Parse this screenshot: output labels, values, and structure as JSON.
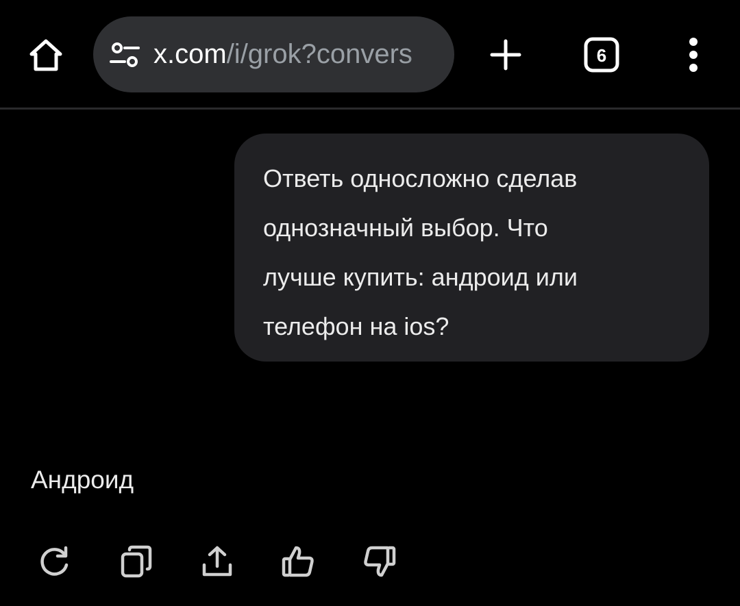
{
  "browser": {
    "url_host": "x.com",
    "url_path": "/i/grok?convers",
    "tab_count": "6",
    "icons": {
      "home": "home-icon",
      "site_settings": "tune-icon",
      "new_tab": "plus-icon",
      "tabs": "tab-switcher-icon",
      "menu": "more-vertical-icon"
    }
  },
  "chat": {
    "user_message": "Ответь односложно сделав\nоднозначный выбор. Что\nлучше купить: андроид или\nтелефон на ios?",
    "assistant_message": "Андроид"
  },
  "actions": {
    "icons": [
      "regenerate-icon",
      "copy-icon",
      "share-icon",
      "thumbs-up-icon",
      "thumbs-down-icon"
    ]
  },
  "colors": {
    "background": "#000000",
    "url_bar": "#2f3033",
    "bubble": "#212124",
    "text": "#ececec",
    "muted": "#9aa0a6"
  }
}
